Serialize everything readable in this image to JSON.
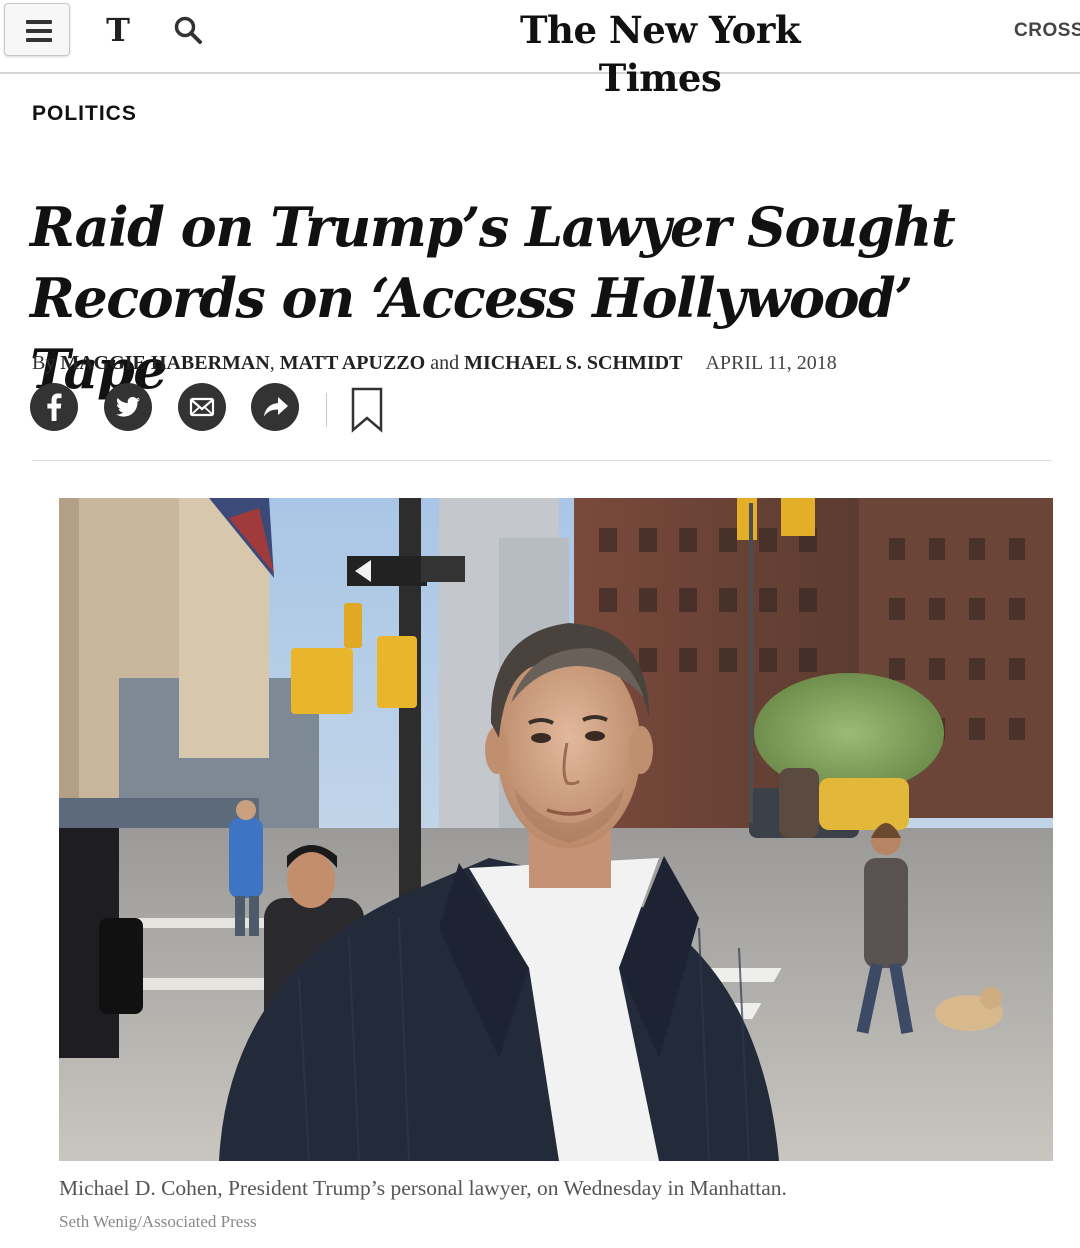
{
  "header": {
    "menu_label": "Menu",
    "t_logo": "T",
    "masthead": "The New York Times",
    "cross_link": "CROSS",
    "icons": [
      "hamburger-icon",
      "nyt-t-icon",
      "search-icon"
    ]
  },
  "article": {
    "section": "POLITICS",
    "headline_line1": "Raid on Trump’s Lawyer Sought",
    "headline_line2": "Records on ‘Access Hollywood’ Tape",
    "byline": {
      "by": "By",
      "author1": "MAGGIE HABERMAN",
      "sep1": ",",
      "author2": "MATT APUZZO",
      "and": "and",
      "author3": "MICHAEL S. SCHMIDT",
      "date": "APRIL 11, 2018"
    },
    "share": {
      "icons": [
        "facebook-icon",
        "twitter-icon",
        "email-icon",
        "share-icon",
        "bookmark-icon"
      ]
    },
    "photo": {
      "caption": "Michael D. Cohen, President Trump’s personal lawyer, on Wednesday in Manhattan.",
      "credit": "Seth Wenig/Associated Press"
    }
  },
  "colors": {
    "text": "#121212",
    "icon_bg": "#333333",
    "rule": "#dcdcdc",
    "caption": "#555555",
    "credit": "#888888"
  }
}
